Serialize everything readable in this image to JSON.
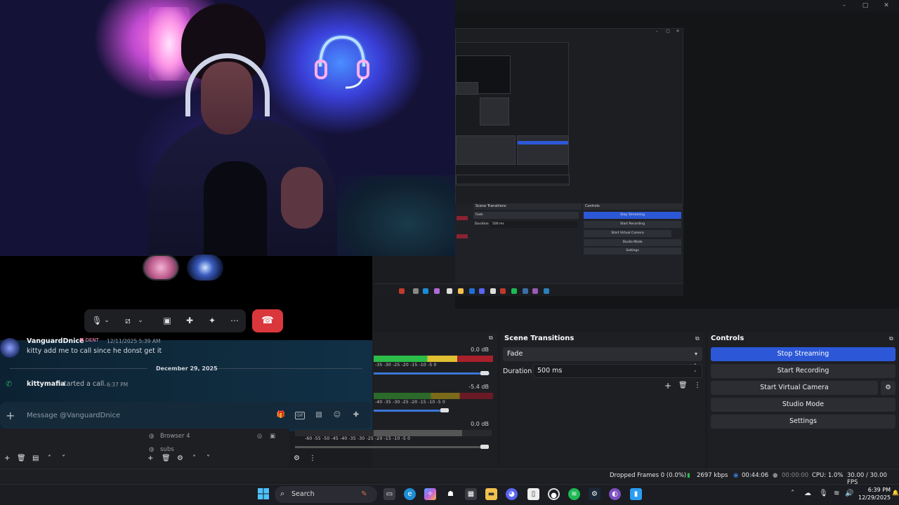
{
  "discord": {
    "message": {
      "user": "VanguardDnice",
      "badge": "♥ DENT",
      "timestamp": "12/11/2025 5:39 AM",
      "text": "kitty add me to call since he donst get it"
    },
    "date_divider": "December 29, 2025",
    "call_event": {
      "user": "kittymafia",
      "text": "started a call.",
      "time": "6:37 PM"
    },
    "input_placeholder": "Message @VanguardDnice",
    "hangup_color": "#da373c"
  },
  "obs": {
    "audio": {
      "db_values": [
        "0.0 dB",
        "-5.4 dB",
        "0.0 dB"
      ],
      "scale": "-60 -55 -50 -45 -40 -35 -30 -25 -20 -15 -10 -5 0",
      "scale_short": "-30 -25 -20 -15 -10 -5 0",
      "scale_partial": "-40 -35 -30 -25 -20 -15 -10 -5 0",
      "scale_first": "-35 -30 -25 -20 -15 -10 -5 0",
      "scale_second": "-40 -35 -30 -25 -20 -15 -10 -5 0",
      "scale_third": "-60 -55 -50 -45 -40 -35 -30 -25 -20 -15 -10 -5 0"
    },
    "scene_transitions": {
      "title": "Scene Transitions",
      "transition": "Fade",
      "duration_label": "Duration",
      "duration_value": "500 ms"
    },
    "controls": {
      "title": "Controls",
      "buttons": [
        "Stop Streaming",
        "Start Recording",
        "Start Virtual Camera",
        "Studio Mode",
        "Settings"
      ],
      "accent": "#2c58d8"
    },
    "sources": {
      "items": [
        "Browser 4",
        "subs"
      ]
    },
    "status": {
      "dropped_frames": "Dropped Frames 0 (0.0%)",
      "bitrate": "2697 kbps",
      "stream_time": "00:44:06",
      "record_time": "00:00:00",
      "cpu": "CPU: 1.0%",
      "fps": "30.00 / 30.00 FPS"
    },
    "mini_preview": {
      "transitions_title": "Scene Transitions",
      "controls_title": "Controls",
      "fade": "Fade",
      "duration": "Duration",
      "duration_value": "500 ms",
      "buttons": [
        "Stop Streaming",
        "Start Recording",
        "Start Virtual Camera",
        "Studio Mode",
        "Settings"
      ]
    }
  },
  "taskbar": {
    "search_label": "Search",
    "time": "6:39 PM",
    "date": "12/29/2025"
  }
}
